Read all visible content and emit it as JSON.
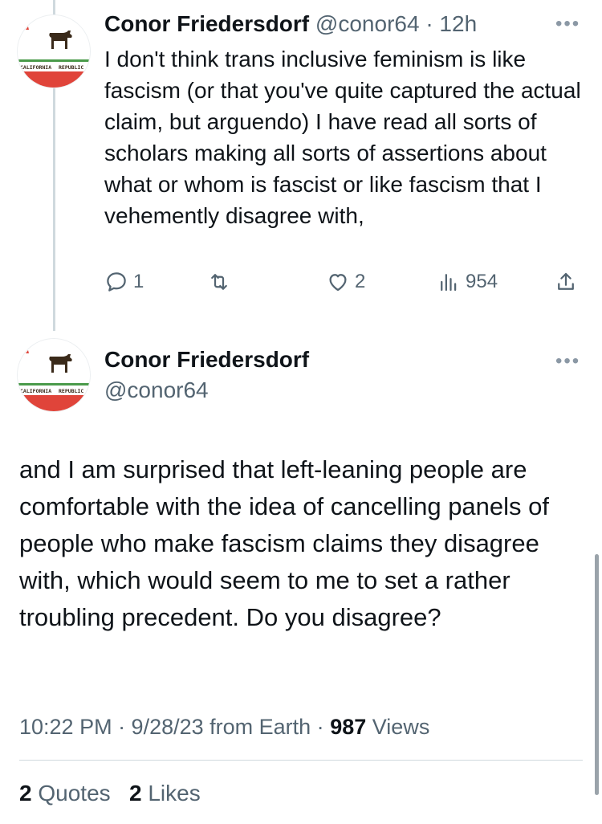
{
  "reply_tweet": {
    "author_name": "Conor Friedersdorf",
    "handle": "@conor64",
    "separator": "·",
    "time": "12h",
    "more_label": "•••",
    "avatar_text_left": "CALIFORNIA",
    "avatar_text_right": "REPUBLIC",
    "body": "I don't think trans inclusive feminism is like fascism (or that you've quite captured the actual claim, but arguendo) I have read all sorts of scholars making all sorts of assertions about what or whom is fascist or like fascism that I vehemently disagree with,",
    "actions": {
      "reply_count": "1",
      "retweet_count": "",
      "like_count": "2",
      "view_count": "954"
    }
  },
  "main_tweet": {
    "author_name": "Conor Friedersdorf",
    "handle": "@conor64",
    "more_label": "•••",
    "avatar_text_left": "CALIFORNIA",
    "avatar_text_right": "REPUBLIC",
    "body": "and I am surprised that left-leaning people are comfortable with the idea of cancelling panels of people who make fascism claims they disagree with, which would seem to me to set a rather troubling precedent. Do you disagree?",
    "timestamp": "10:22 PM · 9/28/23 from Earth ·",
    "views_count": "987",
    "views_label": "Views",
    "quotes_count": "2",
    "quotes_label": "Quotes",
    "likes_count": "2",
    "likes_label": "Likes"
  },
  "colors": {
    "text_primary": "#0f1419",
    "text_secondary": "#536471",
    "thread_line": "#cfd9de",
    "flag_red": "#e0443a",
    "flag_green": "#4a9a4a"
  }
}
